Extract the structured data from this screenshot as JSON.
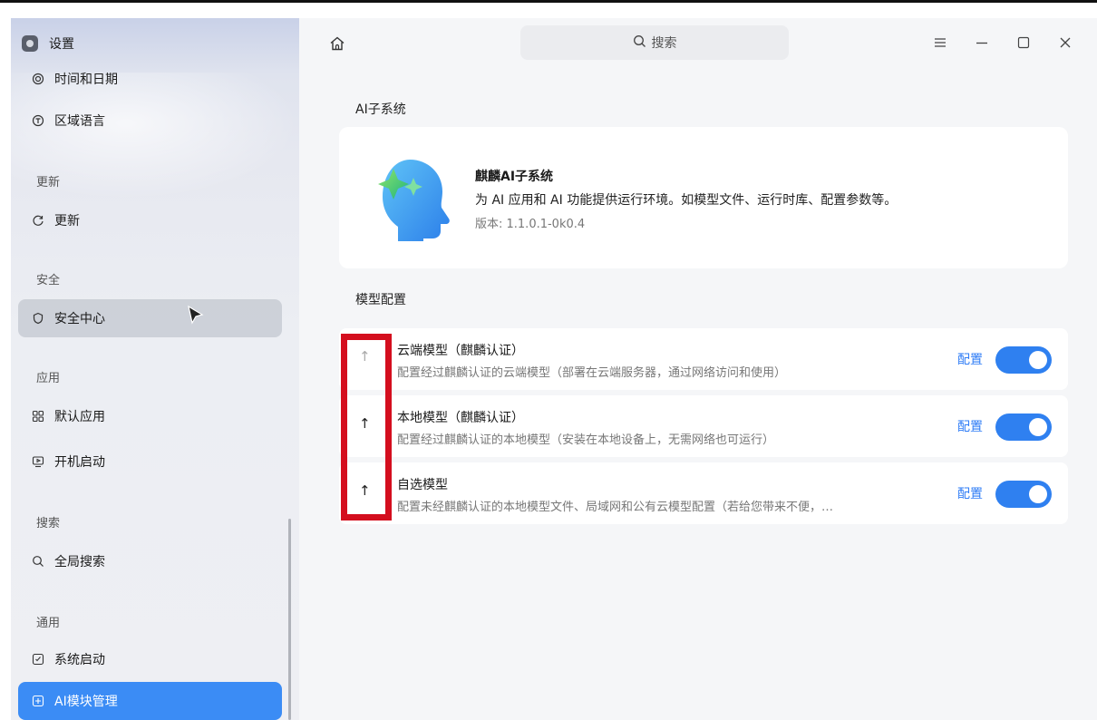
{
  "app": {
    "title": "设置"
  },
  "sidebar": {
    "items": [
      {
        "icon": "clock-icon",
        "label": "时间和日期"
      },
      {
        "icon": "language-icon",
        "label": "区域语言"
      },
      {
        "section": "更新"
      },
      {
        "icon": "refresh-icon",
        "label": "更新"
      },
      {
        "section": "安全"
      },
      {
        "icon": "shield-icon",
        "label": "安全中心"
      },
      {
        "section": "应用"
      },
      {
        "icon": "grid-icon",
        "label": "默认应用"
      },
      {
        "icon": "startup-icon",
        "label": "开机启动"
      },
      {
        "section": "搜索"
      },
      {
        "icon": "search-icon",
        "label": "全局搜索"
      },
      {
        "section": "通用"
      },
      {
        "icon": "system-boot-icon",
        "label": "系统启动"
      },
      {
        "icon": "ai-module-icon",
        "label": "AI模块管理"
      }
    ]
  },
  "header": {
    "search_placeholder": "搜索"
  },
  "main": {
    "section1_title": "AI子系统",
    "card": {
      "title": "麒麟AI子系统",
      "description": "为 AI 应用和 AI 功能提供运行环境。如模型文件、运行时库、配置参数等。",
      "version": "版本: 1.1.0.1-0k0.4"
    },
    "section2_title": "模型配置",
    "models": [
      {
        "title": "云端模型（麒麟认证）",
        "desc": "配置经过麒麟认证的云端模型（部署在云端服务器，通过网络访问和使用）",
        "link": "配置",
        "enabled": true
      },
      {
        "title": "本地模型（麒麟认证）",
        "desc": "配置经过麒麟认证的本地模型（安装在本地设备上，无需网络也可运行）",
        "link": "配置",
        "enabled": true
      },
      {
        "title": "自选模型",
        "desc": "配置未经麒麟认证的本地模型文件、局域网和公有云模型配置（若给您带来不便，…",
        "link": "配置",
        "enabled": true
      }
    ]
  },
  "colors": {
    "accent": "#2f80f0",
    "highlight": "#d40e1e"
  }
}
